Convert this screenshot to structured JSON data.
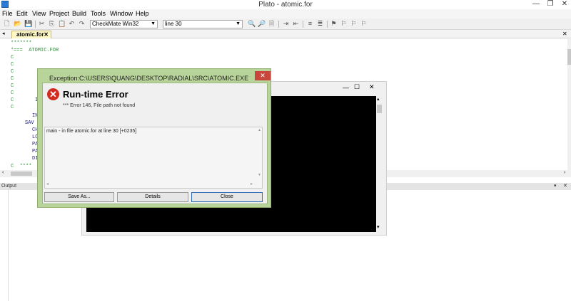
{
  "window": {
    "title": "Plato - atomic.for",
    "controls": {
      "minimize": "—",
      "restore": "❐",
      "close": "✕"
    }
  },
  "menu": [
    "File",
    "Edit",
    "View",
    "Project",
    "Build",
    "Tools",
    "Window",
    "Help"
  ],
  "toolbar": {
    "config_combo": "CheckMate Win32",
    "line_combo": "line 30"
  },
  "tabs": [
    {
      "label": "atomic.for",
      "close": "✕"
    }
  ],
  "editor": {
    "lines": [
      "*******",
      "*===  ATOMIC.FOR",
      "C",
      "C",
      "C",
      "C",
      "C",
      "C",
      "C",
      "C",
      "C",
      "C",
      "C",
      "C  ****"
    ],
    "code_fragments": [
      {
        "text": "I"
      },
      {
        "text": "IN"
      },
      {
        "text": "SAV"
      },
      {
        "text": "CH"
      },
      {
        "text": "LO"
      },
      {
        "text": "PA"
      },
      {
        "text": "PA"
      },
      {
        "text": "DI"
      }
    ]
  },
  "output": {
    "header": "Output"
  },
  "dialog": {
    "title": "Exception:C:\\USERS\\QUANG\\DESKTOP\\RADIAL\\SRC\\ATOMIC.EXE",
    "close": "✕",
    "error_title": "Run-time Error",
    "error_message": "*** Error 146, File path not found",
    "trace": "main -  in file atomic.for at line 30 [+0235]",
    "buttons": {
      "save_as": "Save As...",
      "details": "Details",
      "close": "Close"
    }
  },
  "console_window": {
    "controls": {
      "minimize": "—",
      "maximize": "☐",
      "close": "✕"
    }
  }
}
